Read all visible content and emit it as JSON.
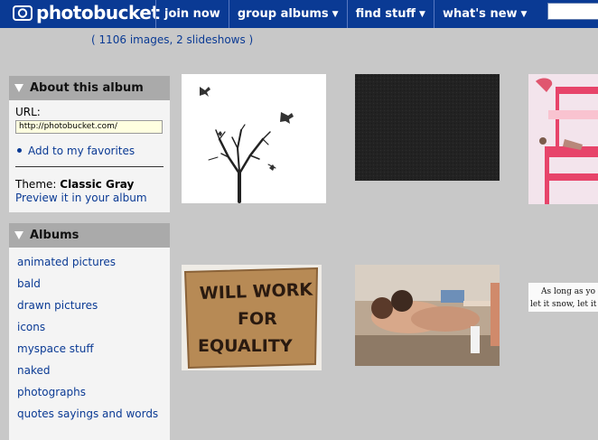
{
  "header": {
    "logo_text": "photobucket",
    "nav": [
      {
        "label": "join now",
        "caret": ""
      },
      {
        "label": "group albums",
        "caret": "▼"
      },
      {
        "label": "find stuff",
        "caret": "▼"
      },
      {
        "label": "what's new",
        "caret": "▼"
      }
    ],
    "search_value": ""
  },
  "album_count": "( 1106 images, 2 slideshows )",
  "about": {
    "title": "About this album",
    "url_label": "URL:",
    "url_value": "http://photobucket.com/",
    "favorites_link": "Add to my favorites",
    "theme_label": "Theme:",
    "theme_name": "Classic Gray",
    "preview_link": "Preview it in your album"
  },
  "albums": {
    "title": "Albums",
    "items": [
      "animated pictures",
      "bald",
      "drawn pictures",
      "icons",
      "myspace stuff",
      "naked",
      "photographs",
      "quotes sayings and words"
    ]
  },
  "thumbnails": {
    "sign_text_lines": [
      "WILL WORK",
      "FOR",
      "EQUALITY"
    ],
    "quote_lines": [
      "As long as yo",
      "let it snow, let it"
    ]
  },
  "colors": {
    "header_bg": "#0a3a94",
    "page_bg": "#c8c8c8",
    "link": "#0a3a94"
  }
}
